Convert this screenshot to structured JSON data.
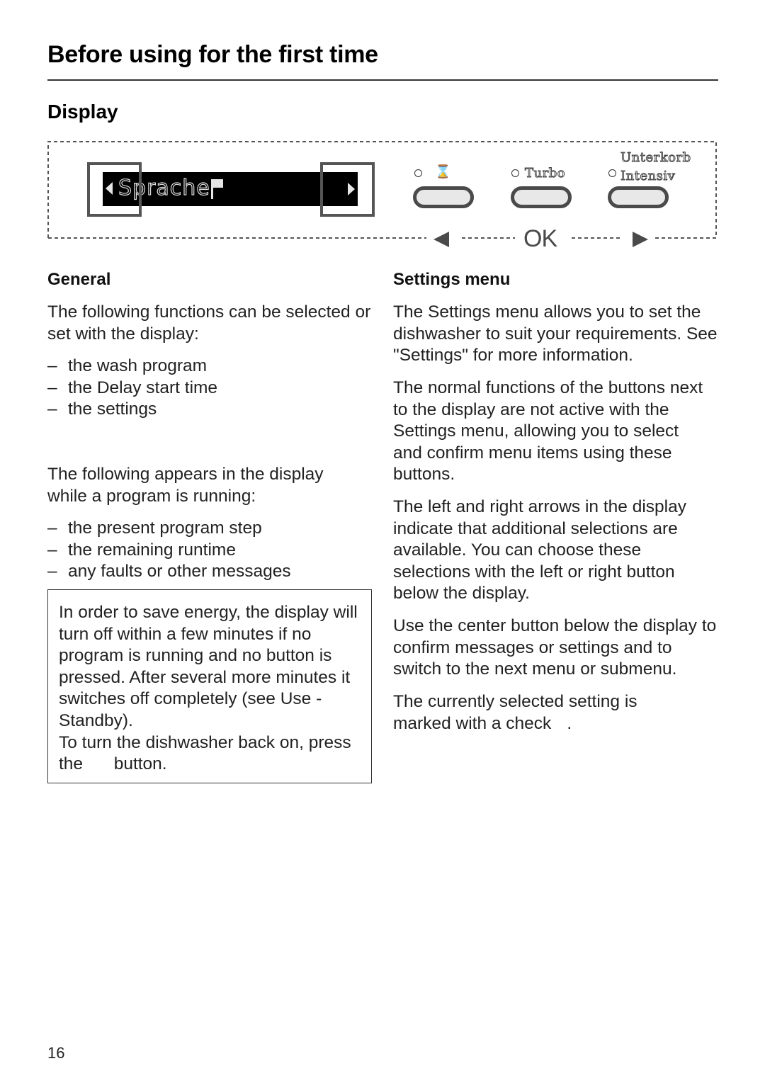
{
  "page": {
    "title": "Before using for the first time",
    "section": "Display",
    "page_number": "16"
  },
  "panel": {
    "screen_text": "Sprache",
    "screen_icons": [
      "arrow-left-icon",
      "flag-icon",
      "arrow-right-icon"
    ],
    "buttons": [
      {
        "label": "⌛",
        "icon": "timer-icon"
      },
      {
        "label": "Turbo"
      },
      {
        "label_top": "Unterkorb",
        "label": "Intensiv"
      }
    ],
    "nav": {
      "left": "left-arrow",
      "center": "OK",
      "right": "right-arrow"
    }
  },
  "general": {
    "heading": "General",
    "intro": "The following functions can be selected or set with the display:",
    "functions": [
      "the wash program",
      "the Delay start time",
      "the settings"
    ],
    "running_intro": "The following appears in the display while a program is running:",
    "running_items": [
      "the present program step",
      "the remaining runtime",
      "any faults or other messages"
    ],
    "note": "In order to save energy, the display will turn off within a few minutes if no program is running and no button is pressed. After several more minutes it switches off completely (see Use - Standby).",
    "note_2a": "To turn the dishwasher back on, press the",
    "note_2b": "button."
  },
  "settings_menu": {
    "heading": "Settings menu",
    "paragraphs": [
      "The Settings menu allows you to set the dishwasher to suit your requirements. See \"Settings\" for more information.",
      "The normal functions of the buttons next to the display are not active with the Settings menu, allowing you to select and confirm menu items using these buttons.",
      "The left and right arrows in the display indicate that additional selections are available. You can choose these selections with the left or right button below the display.",
      "Use the center button below the display to confirm messages or settings and to switch to the next menu or submenu."
    ],
    "check_text_a": "The currently selected setting is marked with a check",
    "check_text_b": "."
  },
  "list_marker": "–"
}
